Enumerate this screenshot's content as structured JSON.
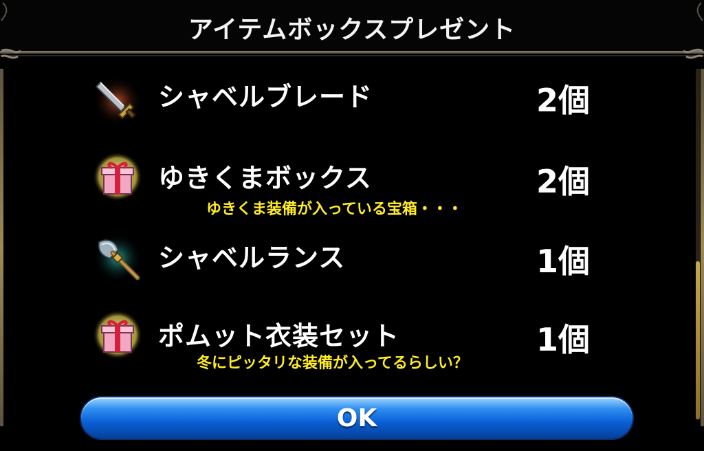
{
  "dialog": {
    "title": "アイテムボックスプレゼント"
  },
  "items": [
    {
      "name": "シャベルブレード",
      "count": "2個",
      "icon": "sword-icon",
      "description": ""
    },
    {
      "name": "ゆきくまボックス",
      "count": "2個",
      "icon": "gift-box-icon",
      "description": "ゆきくま装備が入っている宝箱・・・"
    },
    {
      "name": "シャベルランス",
      "count": "1個",
      "icon": "axe-icon",
      "description": ""
    },
    {
      "name": "ポムット衣装セット",
      "count": "1個",
      "icon": "gift-box-icon",
      "description": "冬にピッタリな装備が入ってるらしい？"
    }
  ],
  "ok_button": {
    "label": "OK"
  },
  "colors": {
    "background": "#000000",
    "text": "#ffffff",
    "description": "#ffec25",
    "button": "#0a5fd6",
    "frame": "#8f8575"
  }
}
